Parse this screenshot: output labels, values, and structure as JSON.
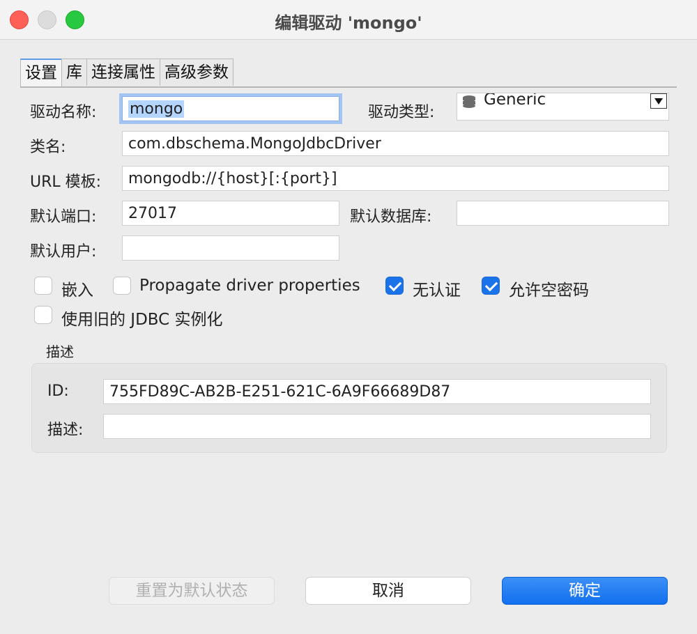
{
  "window": {
    "title": "编辑驱动 'mongo'"
  },
  "tabs": [
    {
      "label": "设置",
      "active": true
    },
    {
      "label": "库",
      "active": false
    },
    {
      "label": "连接属性",
      "active": false
    },
    {
      "label": "高级参数",
      "active": false
    }
  ],
  "settings": {
    "driver_name_label": "驱动名称:",
    "driver_name_value": "mongo",
    "driver_type_label": "驱动类型:",
    "driver_type_value": "Generic",
    "class_name_label": "类名:",
    "class_name_value": "com.dbschema.MongoJdbcDriver",
    "url_template_label": "URL 模板:",
    "url_template_value": "mongodb://{host}[:{port}]",
    "default_port_label": "默认端口:",
    "default_port_value": "27017",
    "default_db_label": "默认数据库:",
    "default_db_value": "",
    "default_user_label": "默认用户:",
    "default_user_value": ""
  },
  "options": {
    "embedded": {
      "label": "嵌入",
      "checked": false
    },
    "propagate": {
      "label": "Propagate driver properties",
      "checked": false
    },
    "no_auth": {
      "label": "无认证",
      "checked": true
    },
    "allow_empty_pwd": {
      "label": "允许空密码",
      "checked": true
    },
    "legacy_jdbc": {
      "label": "使用旧的 JDBC 实例化",
      "checked": false
    }
  },
  "description_group": {
    "title": "描述",
    "id_label": "ID:",
    "id_value": "755FD89C-AB2B-E251-621C-6A9F66689D87",
    "desc_label": "描述:",
    "desc_value": ""
  },
  "buttons": {
    "reset": "重置为默认状态",
    "cancel": "取消",
    "ok": "确定"
  },
  "colors": {
    "accent": "#1a73e8",
    "focus_ring": "#a4c4f3"
  }
}
